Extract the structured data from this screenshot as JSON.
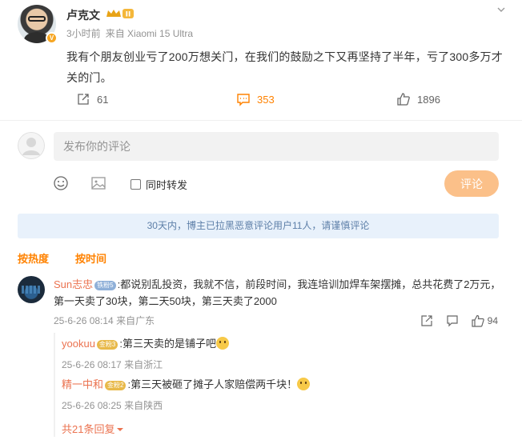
{
  "post": {
    "author": "卢克文",
    "time": "3小时前",
    "source": "来自 Xiaomi 15 Ultra",
    "text": "我有个朋友创业亏了200万想关门，在我们的鼓励之下又再坚持了半年，亏了300多万才关的门。",
    "repost_count": "61",
    "comment_count": "353",
    "like_count": "1896",
    "badge_level": "II"
  },
  "composer": {
    "placeholder": "发布你的评论",
    "repost_label": "同时转发",
    "submit_label": "评论"
  },
  "notice": "30天内，博主已拉黑恶意评论用户11人，请谨慎评论",
  "sort": {
    "hot": "按热度",
    "time": "按时间"
  },
  "comment": {
    "user": "Sun志忠",
    "badge": "铁粉5",
    "text": ":都说别乱投资，我就不信，前段时间，我连培训加焊车架摆摊，总共花费了2万元，第一天卖了30块，第二天50块，第三天卖了2000",
    "time": "25-6-26 08:14",
    "location": "来自广东",
    "likes": "94"
  },
  "replies": [
    {
      "user": "yookuu",
      "badge": "金粉3",
      "text": ":第三天卖的是铺子吧",
      "time": "25-6-26 08:17",
      "location": "来自浙江"
    },
    {
      "user": "精一中和",
      "badge": "金粉2",
      "text": ":第三天被砸了摊子人家赔偿两千块！",
      "time": "25-6-26 08:25",
      "location": "来自陕西"
    }
  ],
  "more_replies": "共21条回复",
  "colors": {
    "accent": "#ff8200",
    "username": "#eb7350",
    "notice_bg": "#e8f1fb",
    "submit_bg": "#fbc089"
  }
}
